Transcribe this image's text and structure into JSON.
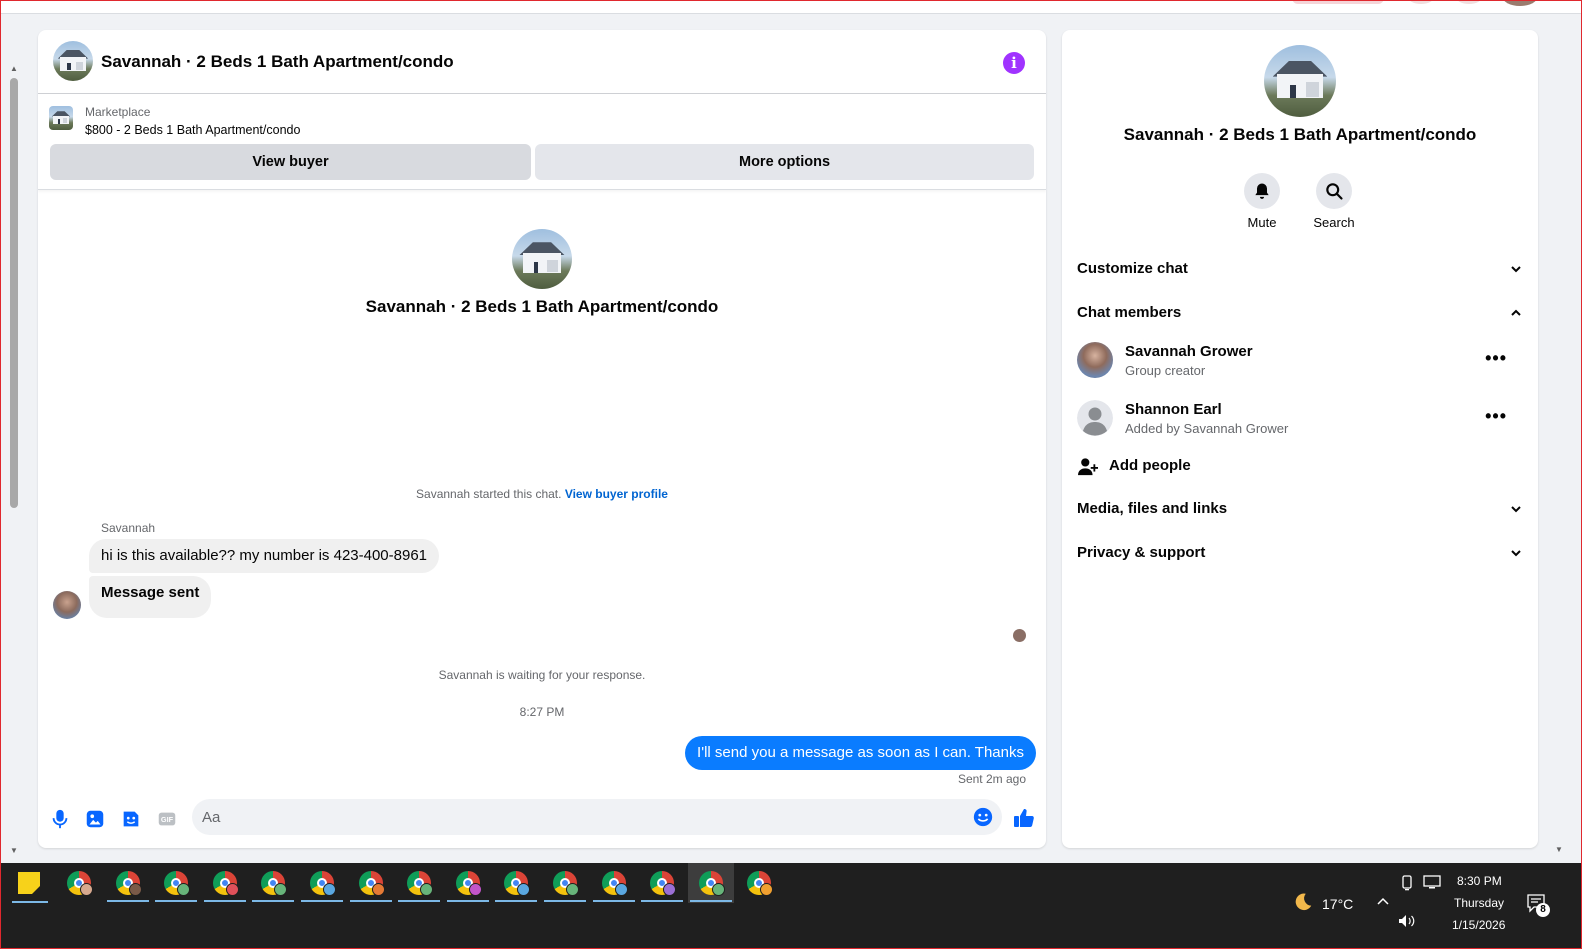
{
  "chat": {
    "title": "Savannah · 2 Beds 1 Bath Apartment/condo",
    "info_icon": "info-icon",
    "marketplace": {
      "label": "Marketplace",
      "listing": "$800 - 2 Beds 1 Bath Apartment/condo",
      "view_buyer": "View buyer",
      "more_options": "More options"
    },
    "intro_title": "Savannah · 2 Beds 1 Bath Apartment/condo",
    "started_text": "Savannah started this chat.",
    "started_link": "View buyer profile",
    "sender_name": "Savannah",
    "incoming": [
      "hi is this available?? my number is 423-400-8961",
      "Message sent"
    ],
    "waiting_text": "Savannah is waiting for your response.",
    "timestamp": "8:27 PM",
    "outgoing": "I'll send you a message as soon as I can. Thanks",
    "sent_status": "Sent 2m ago",
    "composer": {
      "placeholder": "Aa",
      "icons": [
        "microphone-icon",
        "photo-icon",
        "sticker-icon",
        "gif-icon",
        "emoji-icon",
        "thumbs-up-icon"
      ],
      "gif_label": "GIF"
    },
    "accent": "#0a7cff"
  },
  "info_panel": {
    "title": "Savannah · 2 Beds 1 Bath Apartment/condo",
    "actions": [
      {
        "label": "Mute",
        "icon": "bell-icon"
      },
      {
        "label": "Search",
        "icon": "search-icon"
      }
    ],
    "sections": {
      "customize": "Customize chat",
      "members": "Chat members",
      "media": "Media, files and links",
      "privacy": "Privacy & support"
    },
    "members": [
      {
        "name": "Savannah Grower",
        "subtitle": "Group creator"
      },
      {
        "name": "Shannon Earl",
        "subtitle": "Added by Savannah Grower"
      }
    ],
    "add_people": "Add people"
  },
  "taskbar": {
    "weather": {
      "temp": "17°C",
      "icon": "moon-icon"
    },
    "clock": {
      "time": "8:30 PM",
      "day": "Thursday",
      "date": "1/15/2026"
    },
    "notifications": "8",
    "profile_badge_colors": [
      "#d7a98f",
      "#7a5a48",
      "#67b47a",
      "#e0505a",
      "#67b47a",
      "#5aa7e0",
      "#e57a35",
      "#67b47a",
      "#c255c9",
      "#5aa7e0",
      "#67b47a",
      "#5aa7e0",
      "#9b6fd6",
      "#67b47a",
      "#f0a030"
    ]
  }
}
